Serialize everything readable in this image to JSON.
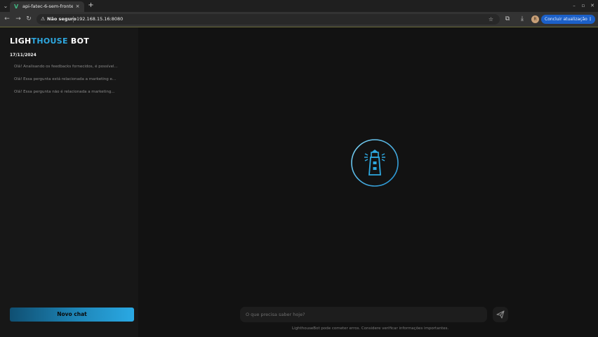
{
  "browser": {
    "tab": {
      "title": "api-fatec-6-sem-fronte",
      "close": "×"
    },
    "new_tab": "+",
    "address": {
      "security_label": "Não seguro",
      "url": "192.168.15.16:8080"
    },
    "update_button": "Concluir atualização",
    "menu_dots": "⋮",
    "profile_initial": "R"
  },
  "sidebar": {
    "logo": {
      "part1": "LIGH",
      "part2": "THOUSE",
      "part3": " BOT"
    },
    "date_heading": "17/11/2024",
    "history": [
      "Olá! Analisando os feedbacks fornecidos, é possível...",
      "Olá! Essa pergunta está relacionada a marketing e...",
      "Olá! Essa pergunta não é relacionada a marketing..."
    ],
    "new_chat_label": "Novo chat"
  },
  "main": {
    "prompt_placeholder": "O que precisa saber hoje?",
    "disclaimer": "LighthouseBot pode cometer erros. Considere verificar informações importantes."
  },
  "colors": {
    "accent": "#2ea8e0",
    "background": "#121212",
    "sidebar": "#171717",
    "update_button": "#1c60c8"
  }
}
